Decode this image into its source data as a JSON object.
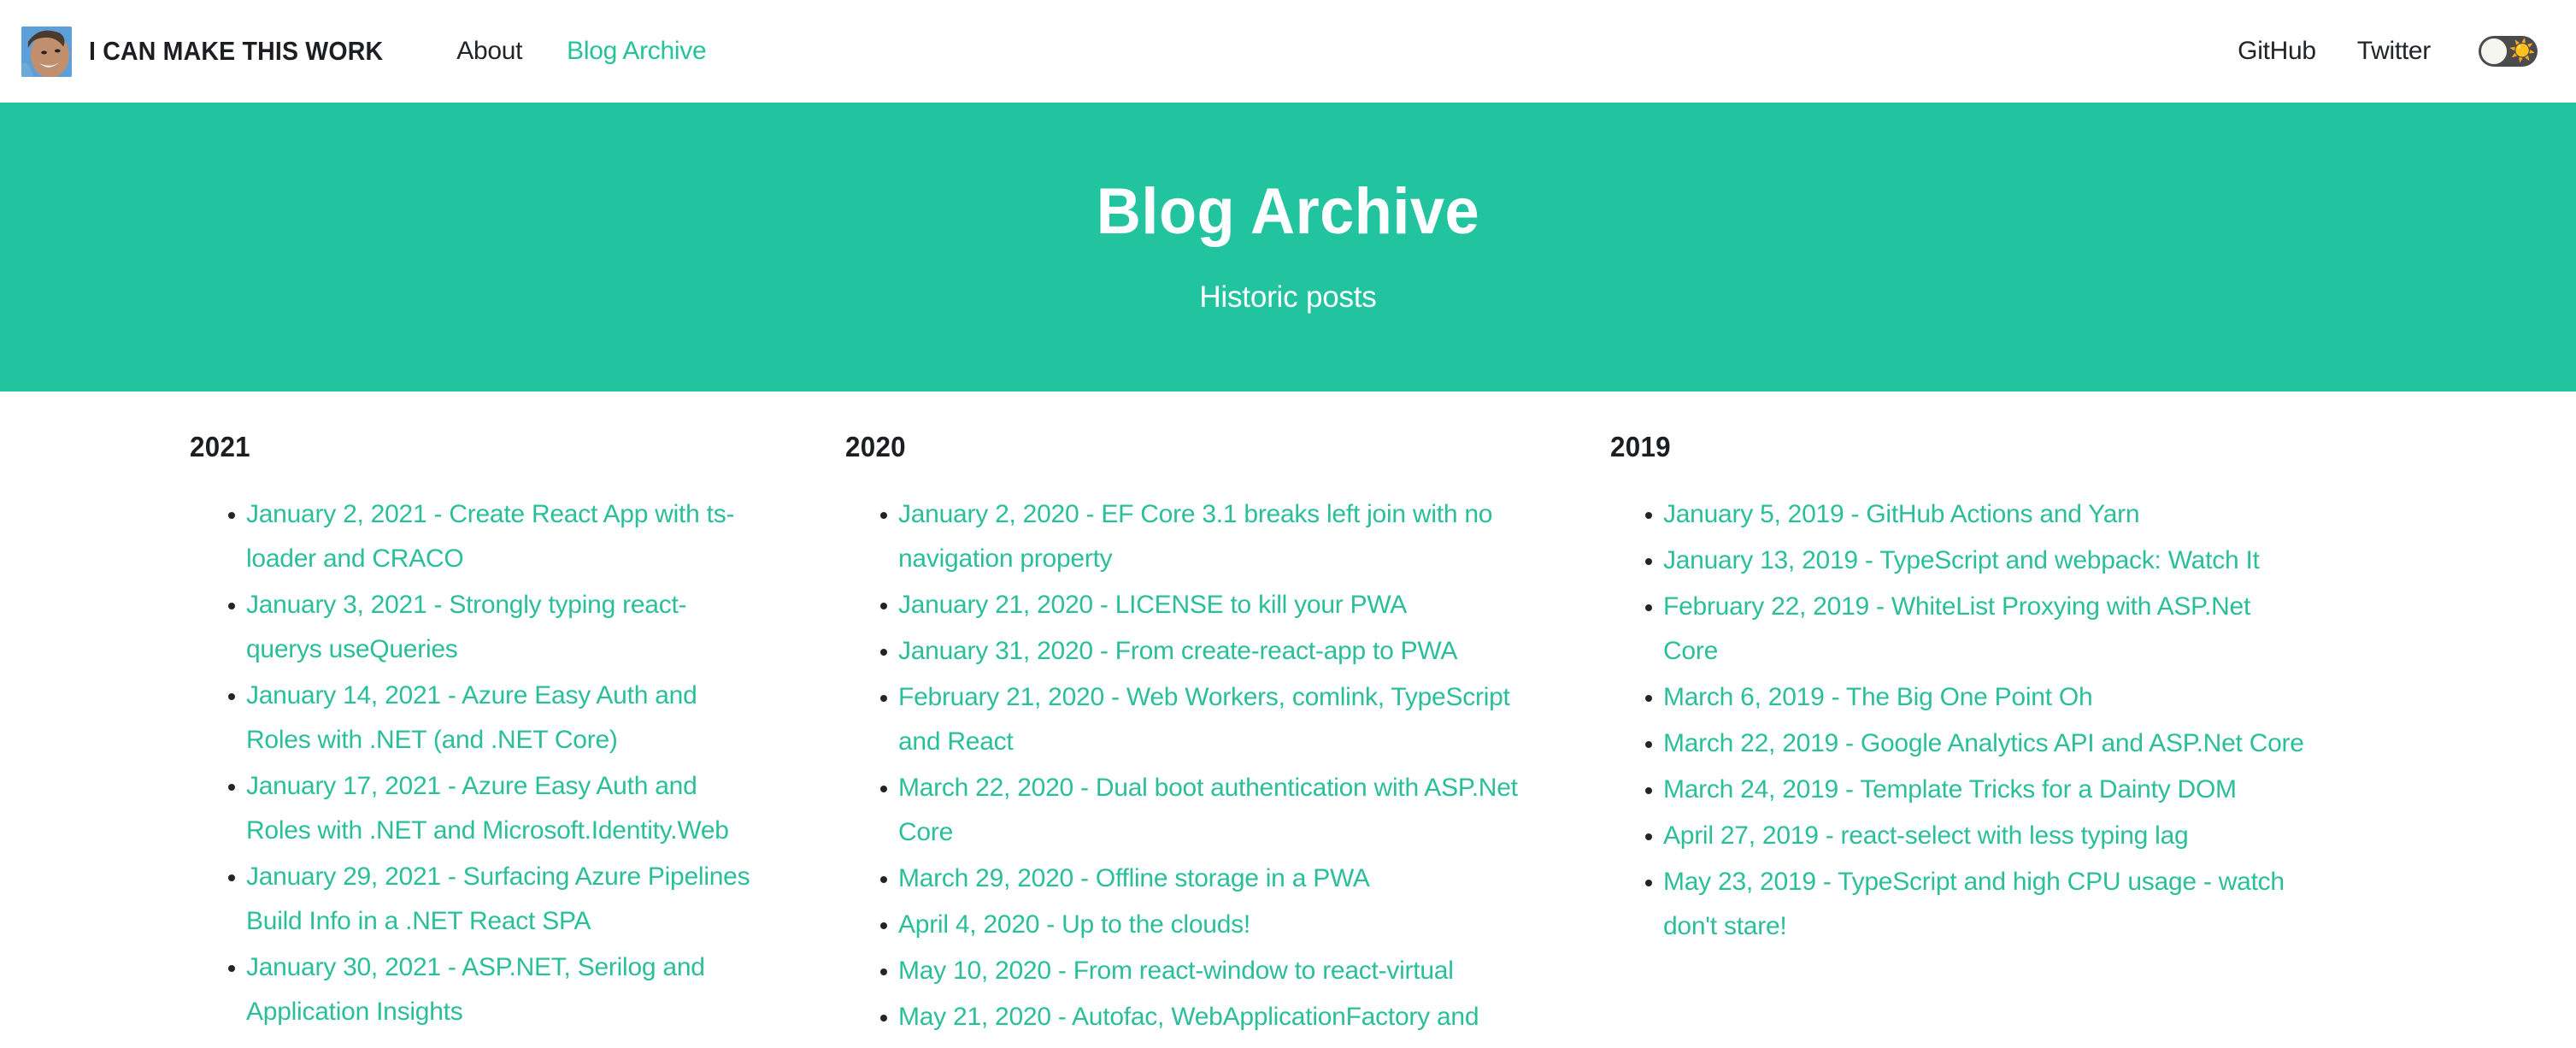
{
  "header": {
    "brand_title": "I CAN MAKE THIS WORK",
    "avatar_alt": "avatar",
    "nav_left": [
      {
        "label": "About",
        "active": false
      },
      {
        "label": "Blog Archive",
        "active": true
      }
    ],
    "nav_right": [
      {
        "label": "GitHub"
      },
      {
        "label": "Twitter"
      }
    ],
    "theme_toggle": {
      "icon": "sun-emoji",
      "glyph": "☀️",
      "state": "light",
      "track_color": "#4b4b4b",
      "knob_color": "#f6f6f1"
    }
  },
  "hero": {
    "title": "Blog Archive",
    "subtitle": "Historic posts",
    "background_color": "#22c4a0",
    "text_color": "#ffffff"
  },
  "theme": {
    "accent": "#22c4a0",
    "link": "#2bbf99",
    "text": "#1c1e21",
    "background": "#ffffff"
  },
  "archive": {
    "columns": [
      {
        "year": "2021",
        "posts": [
          "January 2, 2021 - Create React App with ts-loader and CRACO",
          "January 3, 2021 - Strongly typing react-querys useQueries",
          "January 14, 2021 - Azure Easy Auth and Roles with .NET (and .NET Core)",
          "January 17, 2021 - Azure Easy Auth and Roles with .NET and Microsoft.Identity.Web",
          "January 29, 2021 - Surfacing Azure Pipelines Build Info in a .NET React SPA",
          "January 30, 2021 - ASP.NET, Serilog and Application Insights"
        ]
      },
      {
        "year": "2020",
        "posts": [
          "January 2, 2020 - EF Core 3.1 breaks left join with no navigation property",
          "January 21, 2020 - LICENSE to kill your PWA",
          "January 31, 2020 - From create-react-app to PWA",
          "February 21, 2020 - Web Workers, comlink, TypeScript and React",
          "March 22, 2020 - Dual boot authentication with ASP.Net Core",
          "March 29, 2020 - Offline storage in a PWA",
          "April 4, 2020 - Up to the clouds!",
          "May 10, 2020 - From react-window to react-virtual",
          "May 21, 2020 - Autofac, WebApplicationFactory and"
        ]
      },
      {
        "year": "2019",
        "posts": [
          "January 5, 2019 - GitHub Actions and Yarn",
          "January 13, 2019 - TypeScript and webpack: Watch It",
          "February 22, 2019 - WhiteList Proxying with ASP.Net Core",
          "March 6, 2019 - The Big One Point Oh",
          "March 22, 2019 - Google Analytics API and ASP.Net Core",
          "March 24, 2019 - Template Tricks for a Dainty DOM",
          "April 27, 2019 - react-select with less typing lag",
          "May 23, 2019 - TypeScript and high CPU usage - watch don't stare!"
        ]
      }
    ]
  }
}
